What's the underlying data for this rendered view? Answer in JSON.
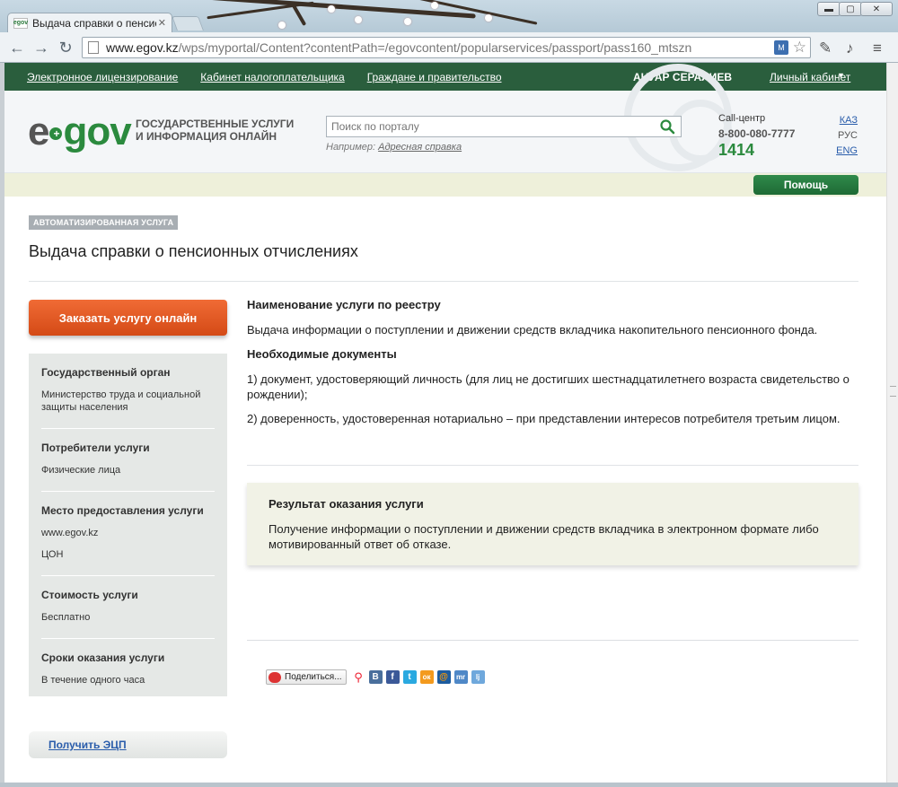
{
  "browser": {
    "tab_title": "Выдача справки о пенсионн",
    "tab_favicon": "egov",
    "url_host": "www.egov.kz",
    "url_path": "/wps/myportal/Content?contentPath=/egovcontent/popularservices/passport/pass160_mtszn",
    "window_min": "▬",
    "window_max": "▢",
    "window_close": "✕"
  },
  "topnav": {
    "links": [
      "Электронное лицензирование",
      "Кабинет налогоплательщика",
      "Граждане и правительство"
    ],
    "user_name": "АНУАР СЕРАЛИЕВ",
    "cabinet": "Личный кабинет"
  },
  "header": {
    "logo_e": "e",
    "logo_gov": "gov",
    "tagline_line1": "ГОСУДАРСТВЕННЫЕ УСЛУГИ",
    "tagline_line2": "И ИНФОРМАЦИЯ ОНЛАЙН",
    "search_placeholder": "Поиск по порталу",
    "example_label": "Например:",
    "example_link": "Адресная справка",
    "callcenter_label": "Call-центр",
    "callcenter_phone": "8-800-080-7777",
    "callcenter_short": "1414",
    "languages": [
      "КАЗ",
      "РУС",
      "ENG"
    ],
    "help_button": "Помощь"
  },
  "service": {
    "badge": "АВТОМАТИЗИРОВАННАЯ УСЛУГА",
    "title": "Выдача справки о пенсионных отчислениях",
    "order_button": "Заказать услугу онлайн",
    "ecp_button": "Получить ЭЦП"
  },
  "sidebar": {
    "blocks": [
      {
        "heading": "Государственный орган",
        "values": [
          "Министерство труда и социальной защиты населения"
        ]
      },
      {
        "heading": "Потребители услуги",
        "values": [
          "Физические лица"
        ]
      },
      {
        "heading": "Место предоставления услуги",
        "values": [
          "www.egov.kz",
          "ЦОН"
        ]
      },
      {
        "heading": "Стоимость услуги",
        "values": [
          "Бесплатно"
        ]
      },
      {
        "heading": "Сроки оказания услуги",
        "values": [
          "В течение одного часа"
        ]
      }
    ]
  },
  "main": {
    "registry_title": "Наименование услуги по реестру",
    "registry_text": "Выдача информации о поступлении и движении средств вкладчика накопительного пенсионного фонда.",
    "docs_title": "Необходимые документы",
    "doc1": "1) документ, удостоверяющий личность (для лиц не достигших шестнадцатилетнего возраста свидетельство о рождении);",
    "doc2": "2) доверенность, удостоверенная нотариально – при представлении интересов потребителя третьим лицом.",
    "result_title": "Результат оказания услуги",
    "result_text": "Получение информации о поступлении и движении средств вкладчика в электронном формате либо мотивированный ответ об отказе."
  },
  "share": {
    "button": "Поделиться...",
    "icons": [
      "B",
      "f",
      "t",
      "ок",
      "@",
      "mr",
      "lj"
    ]
  },
  "colors": {
    "nav_green": "#2a5e3d",
    "brand_green": "#2b8a3e",
    "order_orange": "#e05a22",
    "link_blue": "#2a5dab"
  }
}
